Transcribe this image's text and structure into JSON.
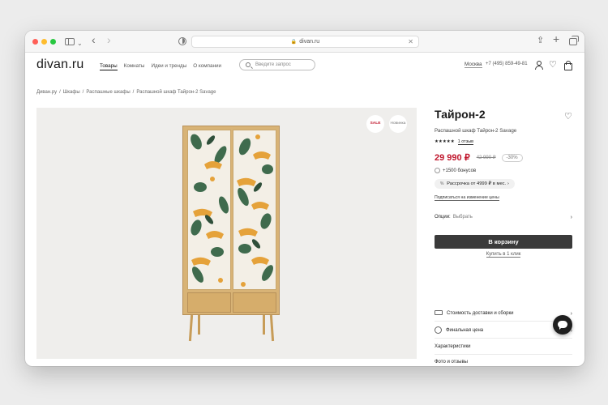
{
  "browser": {
    "url": "divan.ru"
  },
  "header": {
    "logo": "divan.ru",
    "nav": [
      "Товары",
      "Комнаты",
      "Идеи и тренды",
      "О компании"
    ],
    "search_placeholder": "Введите запрос",
    "city": "Москва",
    "phone": "+7 (495) 859-49-81"
  },
  "breadcrumb": [
    "Диван.ру",
    "Шкафы",
    "Распашные шкафы",
    "Распашной шкаф Тайрон-2 Savage"
  ],
  "gallery": {
    "badge_sale": "SALE",
    "badge_new": "Новинка"
  },
  "product": {
    "title": "Тайрон-2",
    "subtitle": "Распашной шкаф Тайрон-2 Savage",
    "stars": "★★★★★",
    "rating_value": 5,
    "reviews": "1 отзыв",
    "price": "29 990 ₽",
    "old_price": "42 990 ₽",
    "discount": "-30%",
    "bonus": "+1500 бонусов",
    "installment_prefix": "%",
    "installment": "Рассрочка от 4999 ₽ в мес.",
    "installment_chev": "›",
    "subscribe": "Подписаться на изменение цены",
    "options_label": "Опции:",
    "options_value": "Выбрать",
    "buy_button": "В корзину",
    "one_click": "Купить в 1 клик",
    "accordion": [
      "Стоимость доставки и сборки",
      "Финальная цена",
      "Характеристики",
      "Фото и отзывы"
    ],
    "chev": "›"
  },
  "colors": {
    "accent_red": "#c0172d",
    "button_dark": "#3a3a3a",
    "gallery_bg": "#efeeec"
  }
}
